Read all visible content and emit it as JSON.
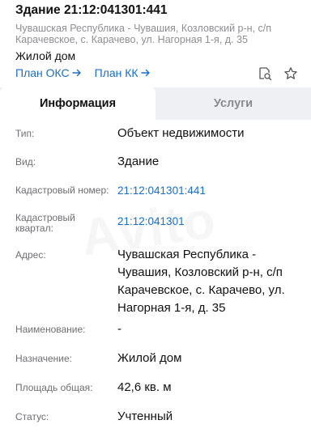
{
  "header": {
    "title": "Здание 21:12:041301:441",
    "address": "Чувашская Республика - Чувашия, Козловский р-н, с/п Карачевское, с. Карачево, ул. Нагорная 1-я, д. 35",
    "kind": "Жилой дом",
    "links": [
      {
        "label": "План ОКС"
      },
      {
        "label": "План КК"
      }
    ],
    "icons": [
      "search-document-icon",
      "star-icon"
    ]
  },
  "tabs": [
    {
      "label": "Информация",
      "active": true
    },
    {
      "label": "Услуги",
      "active": false
    }
  ],
  "details": [
    {
      "label": "Тип:",
      "value": "Объект недвижимости"
    },
    {
      "label": "Вид:",
      "value": "Здание"
    },
    {
      "label": "Кадастровый номер:",
      "value": "21:12:041301:441",
      "link": true
    },
    {
      "label": "Кадастровый квартал:",
      "value": "21:12:041301",
      "link": true
    },
    {
      "label": "Адрес:",
      "value": "Чувашская Республика - Чувашия, Козловский р-н, с/п Карачевское, с. Карачево, ул. Нагорная 1-я, д. 35"
    },
    {
      "label": "Наименование:",
      "value": "-"
    },
    {
      "label": "Назначение:",
      "value": "Жилой дом"
    },
    {
      "label": "Площадь общая:",
      "value": "42,6 кв. м"
    },
    {
      "label": "Статус:",
      "value": "Учтенный"
    }
  ],
  "colors": {
    "link": "#1a6ec8",
    "muted": "#8e8e93",
    "tab_bg": "#eff0f3"
  },
  "watermark": "Avito"
}
